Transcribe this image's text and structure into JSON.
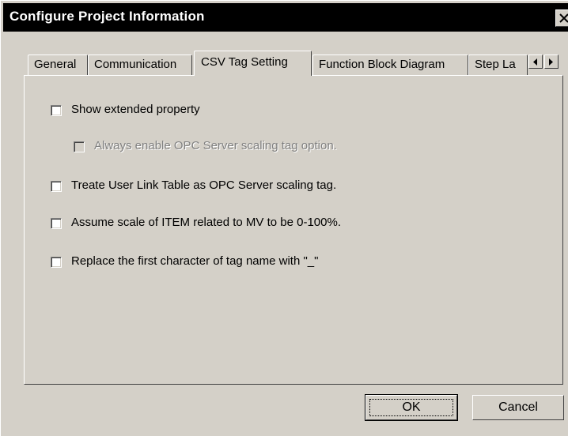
{
  "window": {
    "title": "Configure Project Information"
  },
  "tabs": [
    {
      "label": "General"
    },
    {
      "label": "Communication"
    },
    {
      "label": "CSV Tag Setting",
      "active": true
    },
    {
      "label": "Function Block Diagram"
    },
    {
      "label": "Step La"
    }
  ],
  "options": [
    {
      "label": "Show extended property",
      "checked": false,
      "enabled": true
    },
    {
      "label": "Always enable OPC Server scaling tag option.",
      "checked": false,
      "enabled": false
    },
    {
      "label": "Treate User Link Table as OPC Server scaling tag.",
      "checked": false,
      "enabled": true
    },
    {
      "label": "Assume scale of ITEM related to MV to be 0-100%.",
      "checked": false,
      "enabled": true
    },
    {
      "label": "Replace the first character of tag name with \"_\"",
      "checked": false,
      "enabled": true
    }
  ],
  "buttons": {
    "ok": "OK",
    "cancel": "Cancel"
  },
  "icons": {
    "close": "close-icon",
    "scroll_left": "scroll-left-icon",
    "scroll_right": "scroll-right-icon"
  }
}
